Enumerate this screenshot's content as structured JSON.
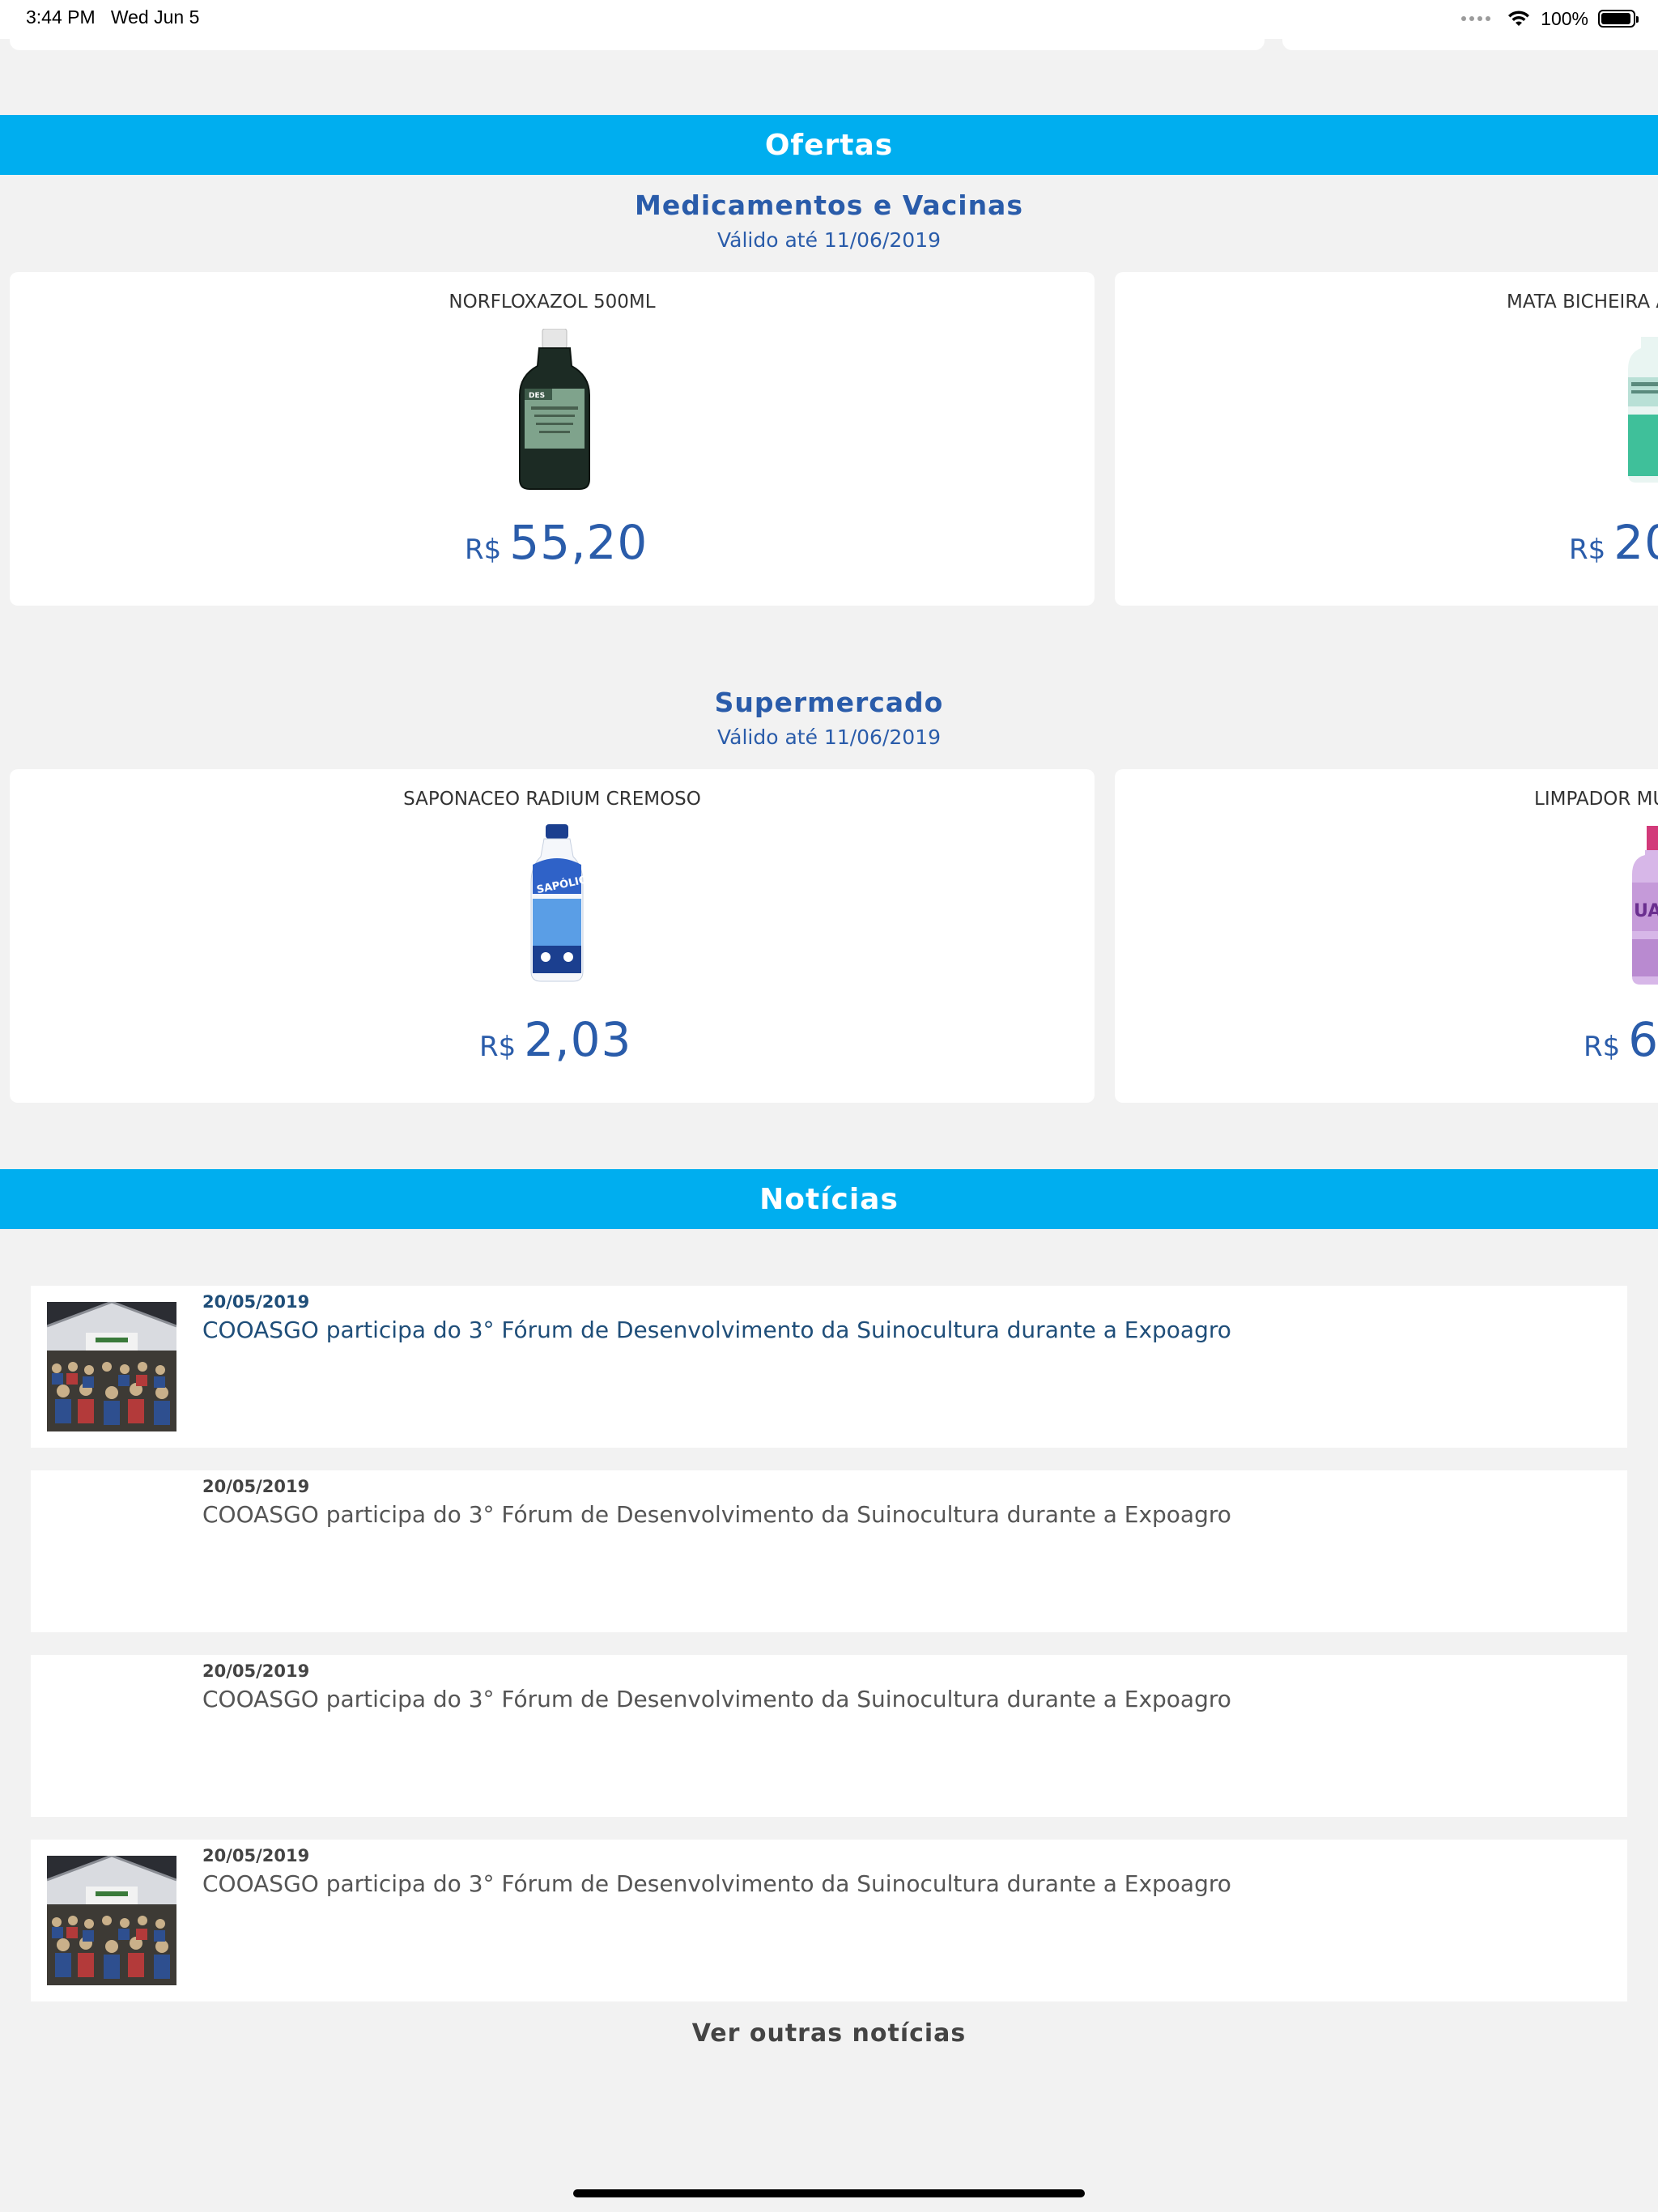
{
  "status_bar": {
    "time": "3:44 PM",
    "date": "Wed Jun 5",
    "battery": "100%"
  },
  "ofertas": {
    "header": "Ofertas",
    "categories": [
      {
        "title": "Medicamentos e Vacinas",
        "valid": "Válido até 11/06/2019",
        "products": [
          {
            "name": "NORFLOXAZOL 500ML",
            "currency": "R$",
            "price": "55,20"
          },
          {
            "name": "MATA BICHEIRA A",
            "currency": "R$",
            "price": "20"
          }
        ]
      },
      {
        "title": "Supermercado",
        "valid": "Válido até 11/06/2019",
        "products": [
          {
            "name": "SAPONACEO RADIUM CREMOSO",
            "currency": "R$",
            "price": "2,03"
          },
          {
            "name": "LIMPADOR MU",
            "currency": "R$",
            "price": "6"
          }
        ]
      }
    ]
  },
  "noticias": {
    "header": "Notícias",
    "items": [
      {
        "date": "20/05/2019",
        "title": "COOASGO participa do 3° Fórum de Desenvolvimento da Suinocultura durante a Expoagro"
      },
      {
        "date": "20/05/2019",
        "title": "COOASGO participa do 3° Fórum de Desenvolvimento da Suinocultura durante a Expoagro"
      },
      {
        "date": "20/05/2019",
        "title": "COOASGO participa do 3° Fórum de Desenvolvimento da Suinocultura durante a Expoagro"
      },
      {
        "date": "20/05/2019",
        "title": "COOASGO participa do 3° Fórum de Desenvolvimento da Suinocultura durante a Expoagro"
      }
    ],
    "more_label": "Ver outras notícias"
  },
  "colors": {
    "accent": "#00aeef",
    "brand_blue": "#2a5caa",
    "news_active": "#1f4e79",
    "background": "#f2f2f2"
  },
  "icons": {
    "signal": "cellular-signal-icon",
    "wifi": "wifi-icon",
    "battery": "battery-icon"
  }
}
